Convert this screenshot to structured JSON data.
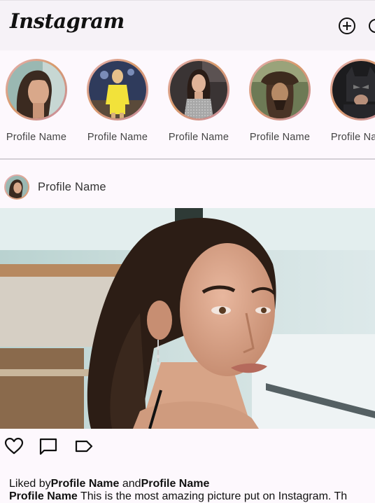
{
  "app": {
    "brand": "Instagram"
  },
  "topbar": {
    "icons": [
      "add-circle-icon",
      "more-icon"
    ]
  },
  "stories": [
    {
      "name": "Profile Name",
      "avatar": "avatar-1"
    },
    {
      "name": "Profile Name",
      "avatar": "avatar-2"
    },
    {
      "name": "Profile Name",
      "avatar": "avatar-3"
    },
    {
      "name": "Profile Name",
      "avatar": "avatar-4"
    },
    {
      "name": "Profile Name",
      "avatar": "avatar-5"
    }
  ],
  "post": {
    "author": "Profile Name",
    "actions": [
      "heart-icon",
      "comment-icon",
      "tag-icon"
    ],
    "liked_by_prefix": "Liked by",
    "liked_by_first": "Profile Name",
    "liked_by_and": "and",
    "liked_by_second": "Profile Name",
    "caption_author": "Profile Name",
    "caption_text": "This is the most amazing picture put on Instagram. Th"
  },
  "colors": {
    "topbar_bg": "#f6f2f7",
    "page_bg": "#fdf8fd",
    "story_ring": "#d99a6a"
  }
}
